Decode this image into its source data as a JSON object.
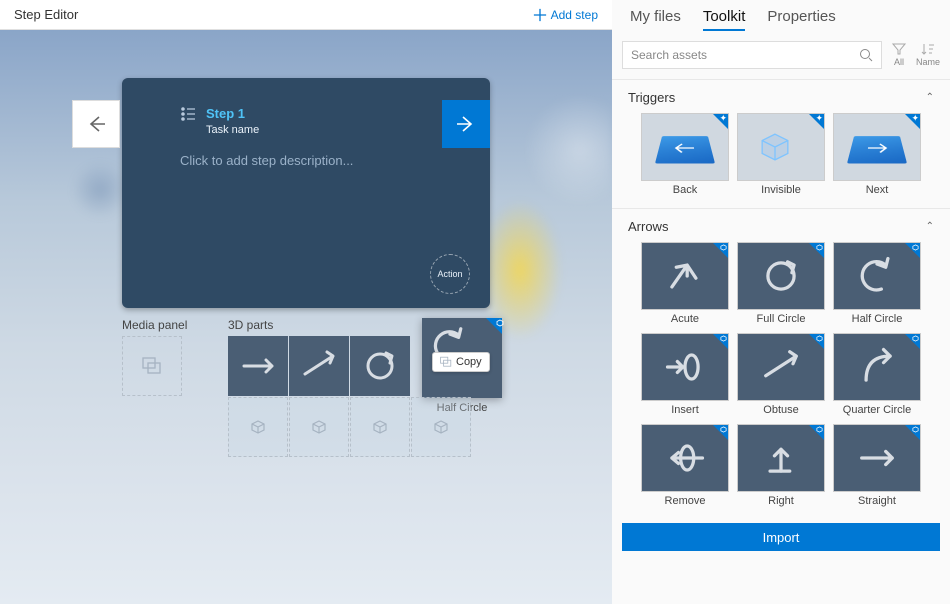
{
  "header": {
    "title": "Step Editor",
    "add_step": "Add step"
  },
  "card": {
    "step_title": "Step 1",
    "task_name": "Task name",
    "desc_placeholder": "Click to add step description...",
    "action_label": "Action"
  },
  "left_panels": {
    "media_label": "Media panel",
    "parts_label": "3D parts",
    "big_part_label": "Half Circle",
    "copy_label": "Copy"
  },
  "tabs": {
    "files": "My files",
    "toolkit": "Toolkit",
    "properties": "Properties"
  },
  "search": {
    "placeholder": "Search assets",
    "filter_all": "All",
    "sort_name": "Name"
  },
  "sections": {
    "triggers": {
      "title": "Triggers",
      "items": [
        {
          "label": "Back",
          "icon": "arrow-left"
        },
        {
          "label": "Invisible",
          "icon": "cube"
        },
        {
          "label": "Next",
          "icon": "arrow-right"
        }
      ]
    },
    "arrows": {
      "title": "Arrows",
      "items": [
        {
          "label": "Acute",
          "icon": "acute"
        },
        {
          "label": "Full Circle",
          "icon": "full-circle"
        },
        {
          "label": "Half Circle",
          "icon": "half-circle"
        },
        {
          "label": "Insert",
          "icon": "insert"
        },
        {
          "label": "Obtuse",
          "icon": "obtuse"
        },
        {
          "label": "Quarter Circle",
          "icon": "quarter"
        },
        {
          "label": "Remove",
          "icon": "remove"
        },
        {
          "label": "Right",
          "icon": "right"
        },
        {
          "label": "Straight",
          "icon": "straight"
        }
      ]
    }
  },
  "import_label": "Import"
}
